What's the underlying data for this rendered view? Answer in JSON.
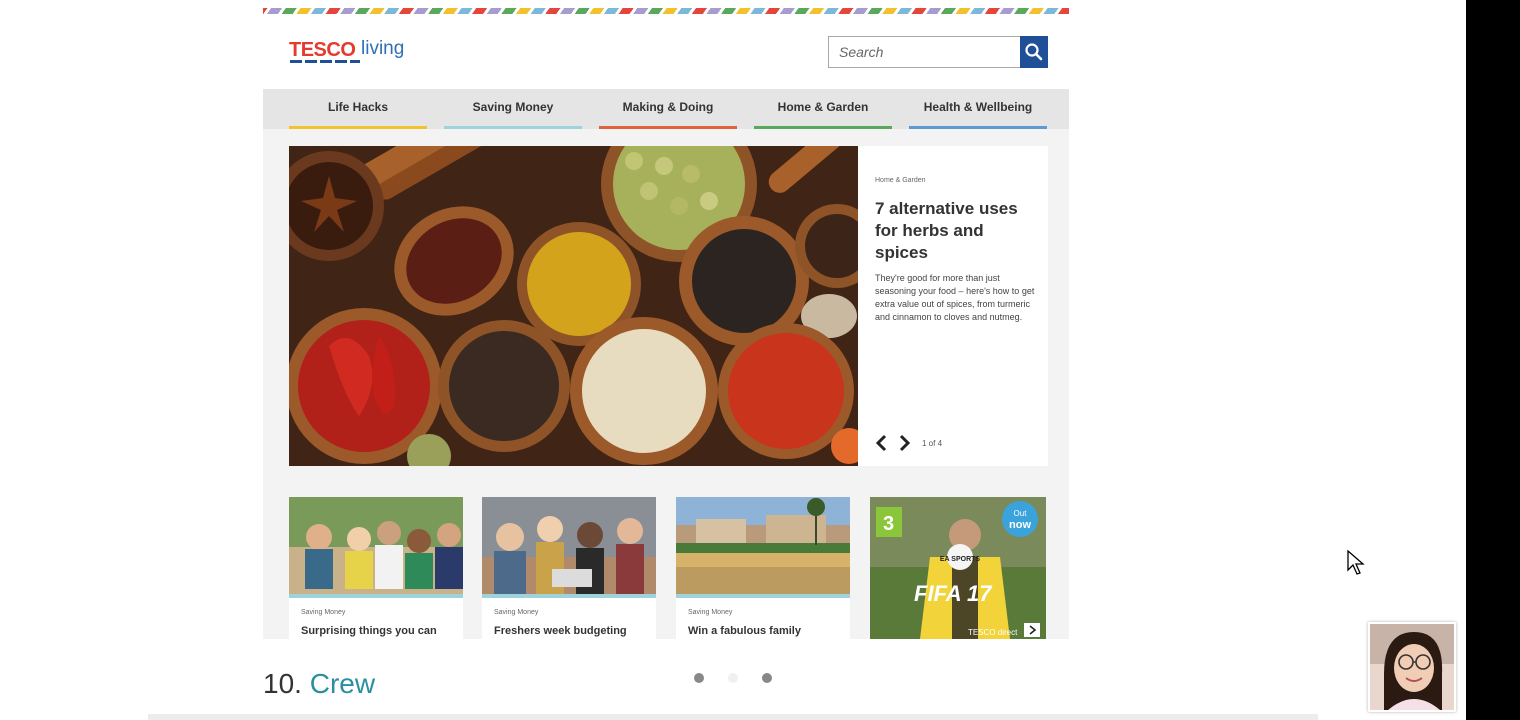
{
  "site": {
    "logo_brand": "TESCO",
    "logo_sub": "living",
    "brand_red": "#e53a2e",
    "brand_blue": "#1f4f96"
  },
  "search": {
    "placeholder": "Search",
    "icon": "magnifier-icon"
  },
  "nav": {
    "items": [
      {
        "label": "Life Hacks",
        "color": "#f2c12e"
      },
      {
        "label": "Saving Money",
        "color": "#9fd3dc"
      },
      {
        "label": "Making & Doing",
        "color": "#e0633a"
      },
      {
        "label": "Home & Garden",
        "color": "#5aa85c"
      },
      {
        "label": "Health & Wellbeing",
        "color": "#5b9bd5"
      }
    ]
  },
  "hero": {
    "category": "Home & Garden",
    "title": "7 alternative uses for herbs and spices",
    "description": "They're good for more than just seasoning your food – here's how to get extra value out of spices, from turmeric and cinnamon to cloves and nutmeg.",
    "counter": "1 of 4",
    "prev_icon": "chevron-left-icon",
    "next_icon": "chevron-right-icon"
  },
  "tiles": [
    {
      "category": "Saving Money",
      "title": "Surprising things you can"
    },
    {
      "category": "Saving Money",
      "title": "Freshers week budgeting"
    },
    {
      "category": "Saving Money",
      "title": "Win a fabulous family"
    }
  ],
  "ad": {
    "age_rating": "3",
    "badge_line1": "Out",
    "badge_line2": "now",
    "game_title": "FIFA 17",
    "publisher": "EA SPORTS",
    "retailer": "TESCO direct"
  },
  "slide": {
    "number": "10.",
    "word": "Crew",
    "accent": "#2a8fa0"
  },
  "pager": {
    "total": 3,
    "active": [
      true,
      false,
      true
    ]
  }
}
